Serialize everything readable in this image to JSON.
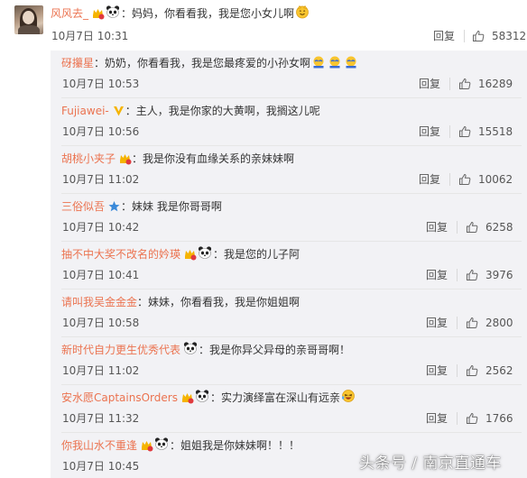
{
  "main_comment": {
    "username": "风风去_",
    "text": "：妈妈，你看看我，我是您小女儿啊",
    "time": "10月7日 10:31",
    "reply_label": "回复",
    "likes": "58312"
  },
  "replies": [
    {
      "username": "砑攥星",
      "text": "：奶奶，你看看我，我是您最疼爱的小孙女啊",
      "time": "10月7日 10:53",
      "reply_label": "回复",
      "likes": "16289"
    },
    {
      "username": "Fujiawei-",
      "text": "：主人，我是你家的大黄啊，我搁这儿呢",
      "time": "10月7日 10:56",
      "reply_label": "回复",
      "likes": "15518"
    },
    {
      "username": "胡桃小夹子",
      "text": "：我是你没有血缘关系的亲妹妹啊",
      "time": "10月7日 11:02",
      "reply_label": "回复",
      "likes": "10062"
    },
    {
      "username": "三俗似吾",
      "text": "：妹妹 我是你哥哥啊",
      "time": "10月7日 10:42",
      "reply_label": "回复",
      "likes": "6258"
    },
    {
      "username": "抽不中大奖不改名的妗瑛",
      "text": "：我是您的儿子阿",
      "time": "10月7日 10:41",
      "reply_label": "回复",
      "likes": "3976"
    },
    {
      "username": "请叫我吴金金金",
      "text": "：妹妹，你看看我，我是你姐姐啊",
      "time": "10月7日 10:58",
      "reply_label": "回复",
      "likes": "2800"
    },
    {
      "username": "新时代自力更生优秀代表",
      "text": "：我是你异父异母的亲哥哥啊！",
      "time": "10月7日 11:02",
      "reply_label": "回复",
      "likes": "2562"
    },
    {
      "username": "安水愿CaptainsOrders",
      "text": "：实力演绎富在深山有远亲",
      "time": "10月7日 11:32",
      "reply_label": "回复",
      "likes": "1766"
    },
    {
      "username": "你我山水不重逢",
      "text": "：姐姐我是你妹妹啊！！！",
      "time": "10月7日 10:45",
      "reply_label": "",
      "likes": ""
    }
  ],
  "watermark": "头条号 / 南京直通车",
  "colors": {
    "username": "#eb7350",
    "replies_bg": "#f2f2f5",
    "vip_badge": "#f5b400",
    "heart": "#e0393e"
  }
}
